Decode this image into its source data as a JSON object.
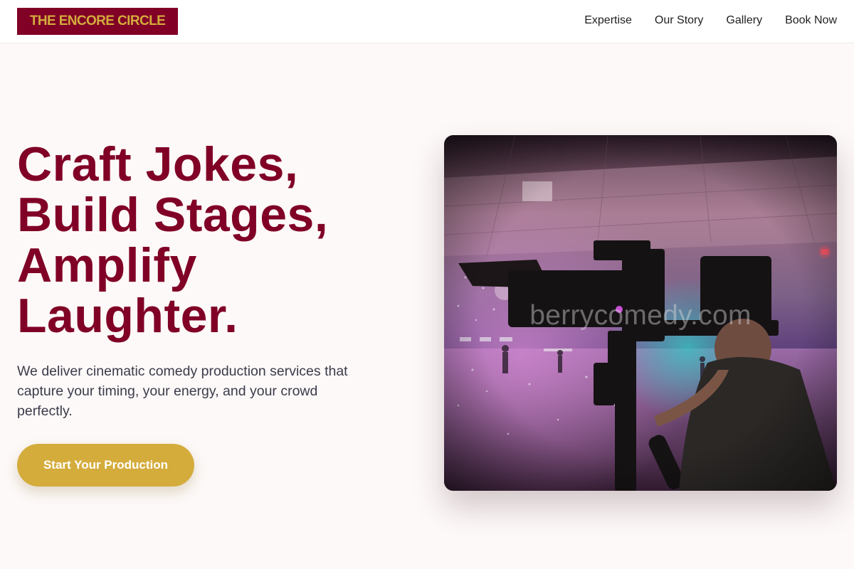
{
  "header": {
    "logo": "THE ENCORE CIRCLE",
    "nav": [
      "Expertise",
      "Our Story",
      "Gallery",
      "Book Now"
    ]
  },
  "hero": {
    "title_lines": [
      "Craft Jokes,",
      "Build Stages,",
      "Amplify",
      "Laughter."
    ],
    "subtitle": "We deliver cinematic comedy production services that capture your timing, your energy, and your crowd perfectly.",
    "cta": "Start Your Production",
    "image_watermark": "berrycomedy.com"
  },
  "colors": {
    "brand": "#800026",
    "accent": "#d4ac3c",
    "background": "#fdf9f8",
    "body_text": "#3b3b4b"
  }
}
